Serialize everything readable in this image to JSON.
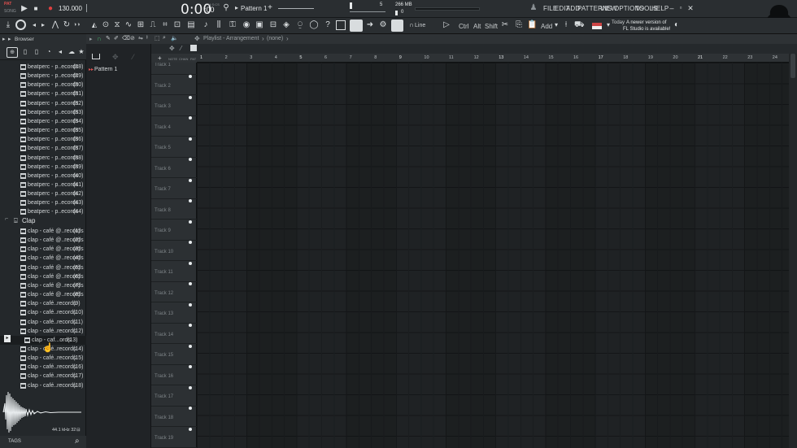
{
  "transport": {
    "mode_pat": "PAT",
    "mode_song": "SONG",
    "tempo": "130.000",
    "time": "0:00",
    "time_small": ":00",
    "time_unit": "M:S:CS",
    "pattern": "Pattern 1",
    "cpu_value": "5",
    "memory": "266 MB",
    "voices": "0"
  },
  "menu": [
    "FILE",
    "EDIT",
    "ADD",
    "PATTERNS",
    "VIEW",
    "OPTIONS",
    "TOOLS",
    "HELP"
  ],
  "toolbar": {
    "snap_label": "Line",
    "ctrl": "Ctrl",
    "alt": "Alt",
    "shift": "Shift",
    "add": "Add",
    "hint_title": "Today",
    "hint_line1": "A newer version of",
    "hint_line2": "FL Studio is available!"
  },
  "browser": {
    "title": "Browser",
    "items_before": [
      {
        "label": "beatperc - p..ecords",
        "num": "(28)"
      },
      {
        "label": "beatperc - p..ecords",
        "num": "(29)"
      },
      {
        "label": "beatperc - p..ecords",
        "num": "(30)"
      },
      {
        "label": "beatperc - p..ecords",
        "num": "(31)"
      },
      {
        "label": "beatperc - p..ecords",
        "num": "(32)"
      },
      {
        "label": "beatperc - p..ecords",
        "num": "(33)"
      },
      {
        "label": "beatperc - p..ecords",
        "num": "(34)"
      },
      {
        "label": "beatperc - p..ecords",
        "num": "(35)"
      },
      {
        "label": "beatperc - p..ecords",
        "num": "(36)"
      },
      {
        "label": "beatperc - p..ecords",
        "num": "(37)"
      },
      {
        "label": "beatperc - p..ecords",
        "num": "(38)"
      },
      {
        "label": "beatperc - p..ecords",
        "num": "(39)"
      },
      {
        "label": "beatperc - p..ecords",
        "num": "(40)"
      },
      {
        "label": "beatperc - p..ecords",
        "num": "(41)"
      },
      {
        "label": "beatperc - p..ecords",
        "num": "(42)"
      },
      {
        "label": "beatperc - p..ecords",
        "num": "(43)"
      },
      {
        "label": "beatperc - p..ecords",
        "num": "(44)"
      }
    ],
    "folder": "Clap",
    "clap_items": [
      {
        "label": "clap - café @..records",
        "num": "(1)"
      },
      {
        "label": "clap - café @..records",
        "num": "(2)"
      },
      {
        "label": "clap - café @..records",
        "num": "(3)"
      },
      {
        "label": "clap - café @..records",
        "num": "(4)"
      },
      {
        "label": "clap - café @..records",
        "num": "(5)"
      },
      {
        "label": "clap - café @..records",
        "num": "(6)"
      },
      {
        "label": "clap - café @..records",
        "num": "(7)"
      },
      {
        "label": "clap - café @..records",
        "num": "(8)"
      },
      {
        "label": "clap - café..records",
        "num": "(9)"
      },
      {
        "label": "clap - café..records",
        "num": "(10)"
      },
      {
        "label": "clap - café..records",
        "num": "(11)"
      },
      {
        "label": "clap - café..records",
        "num": "(12)"
      },
      {
        "label": "clap - caf...ords",
        "num": "(13)"
      },
      {
        "label": "clap - café..records",
        "num": "(14)"
      },
      {
        "label": "clap - café..records",
        "num": "(15)"
      },
      {
        "label": "clap - café..records",
        "num": "(16)"
      },
      {
        "label": "clap - café..records",
        "num": "(17)"
      },
      {
        "label": "clap - café..records",
        "num": "(18)"
      }
    ],
    "sample_info": "44.1 kHz 32",
    "tags": "TAGS"
  },
  "picker": {
    "pattern_item": "Pattern 1"
  },
  "playlist": {
    "title": "Playlist - Arrangement",
    "breadcrumb_sep": "›",
    "selection": "(none)",
    "col_note": "NOTE",
    "col_chan": "CHAN",
    "col_pat": "PAT",
    "bars": [
      "1",
      "2",
      "3",
      "4",
      "5",
      "6",
      "7",
      "8",
      "9",
      "10",
      "11",
      "12",
      "13",
      "14",
      "15",
      "16",
      "17",
      "18",
      "19",
      "20",
      "21",
      "22",
      "23",
      "24"
    ],
    "tracks": [
      "Track 1",
      "Track 2",
      "Track 3",
      "Track 4",
      "Track 5",
      "Track 6",
      "Track 7",
      "Track 8",
      "Track 9",
      "Track 10",
      "Track 11",
      "Track 12",
      "Track 13",
      "Track 14",
      "Track 15",
      "Track 16",
      "Track 17",
      "Track 18",
      "Track 19"
    ]
  },
  "colors": {
    "accent_red": "#e0504f",
    "record_red": "#e04040",
    "panel": "#2a2e31",
    "grid": "#1f2224"
  }
}
